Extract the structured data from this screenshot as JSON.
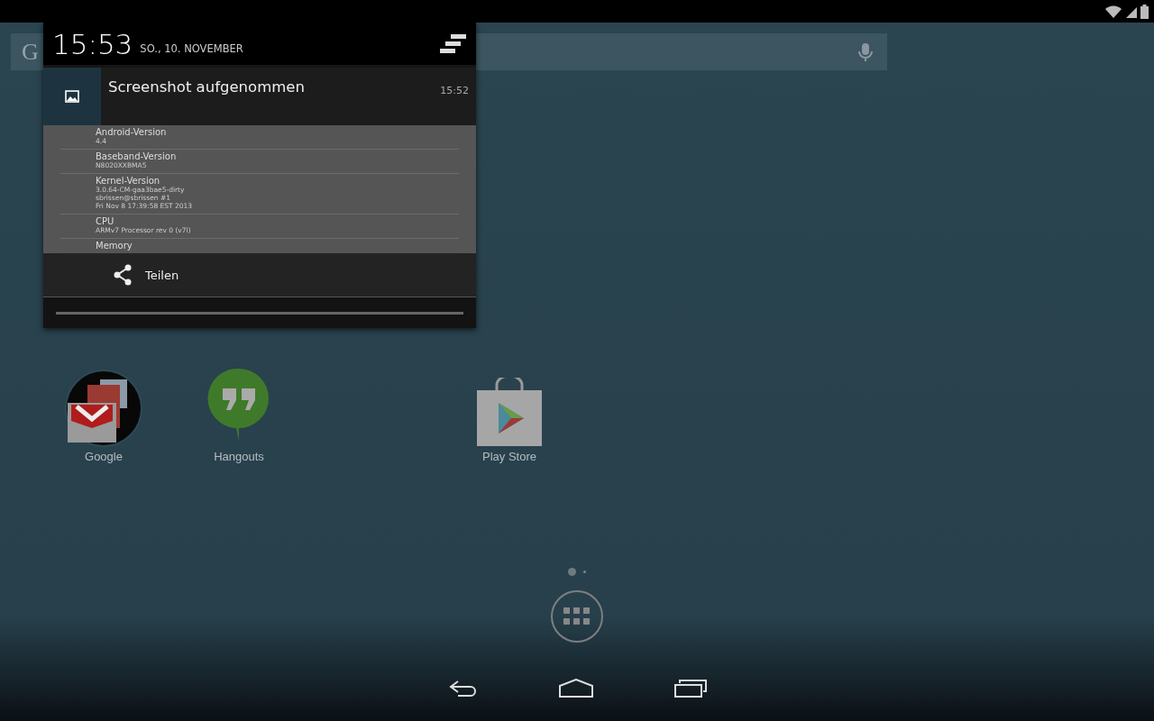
{
  "search": {
    "text": "G"
  },
  "notification_shade": {
    "time": "15:53",
    "date": "SO., 10. NOVEMBER",
    "notification": {
      "title": "Screenshot aufgenommen",
      "time": "15:52",
      "preview": [
        {
          "label": "Android-Version",
          "lines": [
            "4.4"
          ]
        },
        {
          "label": "Baseband-Version",
          "lines": [
            "N8020XXBMA5"
          ]
        },
        {
          "label": "Kernel-Version",
          "lines": [
            "3.0.64-CM-gaa3bae5-dirty",
            "sbrissen@sbrissen #1",
            "Fri Nov 8 17:39:58 EST 2013"
          ]
        },
        {
          "label": "CPU",
          "lines": [
            "ARMv7 Processor rev 0 (v7l)"
          ]
        },
        {
          "label": "Memory"
        }
      ],
      "action": "Teilen"
    }
  },
  "apps": [
    {
      "label": "Google",
      "kind": "folder"
    },
    {
      "label": "Hangouts",
      "kind": "hangouts"
    },
    {
      "label": "Play Store",
      "kind": "store"
    }
  ],
  "pages": [
    {
      "selected": true
    },
    {
      "selected": false
    }
  ]
}
